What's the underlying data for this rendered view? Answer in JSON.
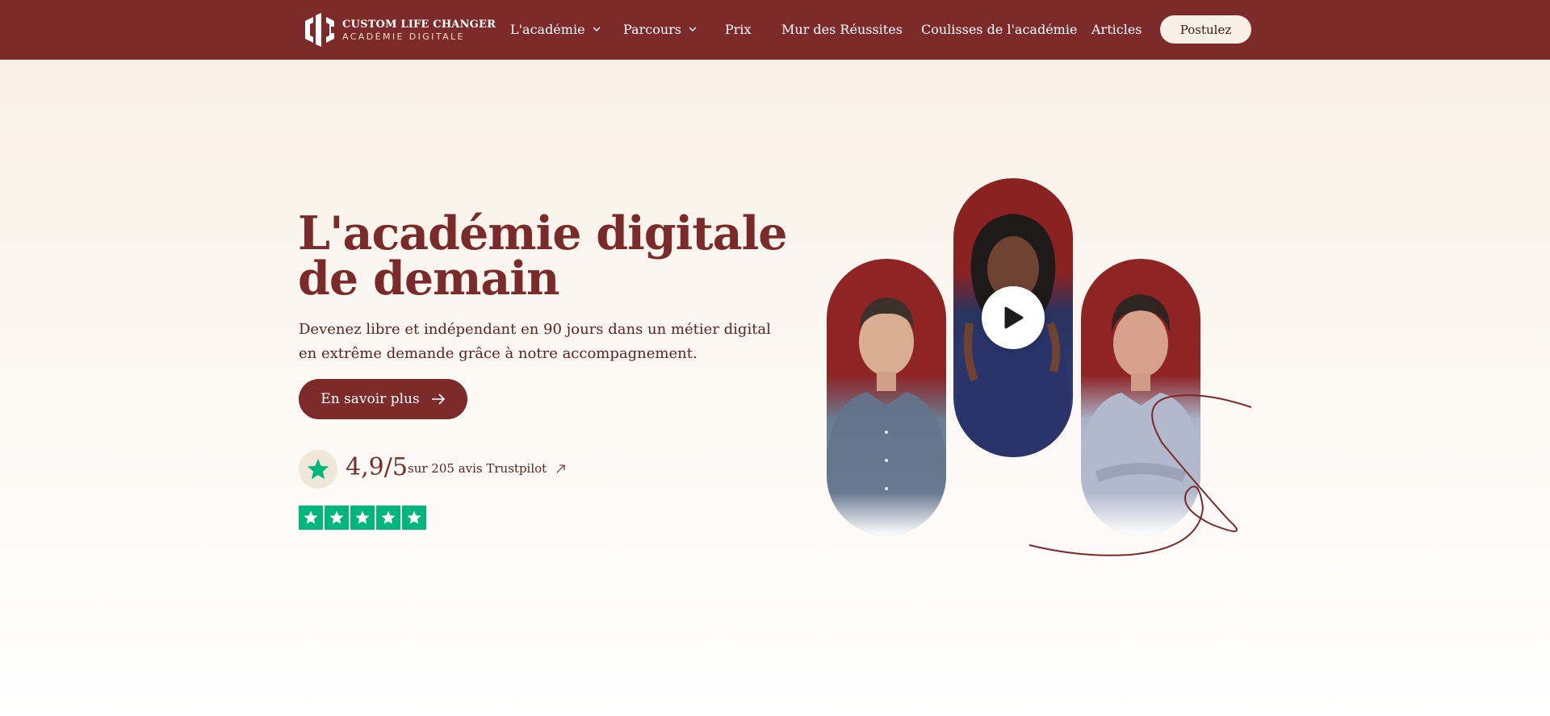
{
  "brand": {
    "title": "CUSTOM LIFE CHANGER",
    "subtitle": "ACADÉMIE DIGITALE"
  },
  "nav": {
    "items": [
      {
        "label": "L'académie",
        "dropdown": true
      },
      {
        "label": "Parcours",
        "dropdown": true
      },
      {
        "label": "Prix",
        "dropdown": false
      },
      {
        "label": "Mur des Réussites",
        "dropdown": false
      },
      {
        "label": "Coulisses de l'académie",
        "dropdown": false
      },
      {
        "label": "Articles",
        "dropdown": false
      }
    ],
    "cta_label": "Postulez"
  },
  "hero": {
    "title": "L'académie digitale de demain",
    "subtitle": "Devenez libre et indépendant en 90 jours dans un métier digital en extrême demande grâce à notre accompagnement.",
    "cta_label": "En savoir plus",
    "cta_icon": "arrow-right-icon"
  },
  "rating": {
    "score": "4,9/5",
    "text": "sur 205 avis Trustpilot",
    "link_icon": "external-arrow-icon",
    "stars": 5
  },
  "media": {
    "play_icon": "play-icon",
    "people": [
      "person-left",
      "person-center",
      "person-right"
    ]
  },
  "colors": {
    "brand": "#7c2a2a",
    "cream": "#f8efe5",
    "trustpilot": "#00b67a",
    "star_badge": "#00b67a"
  }
}
